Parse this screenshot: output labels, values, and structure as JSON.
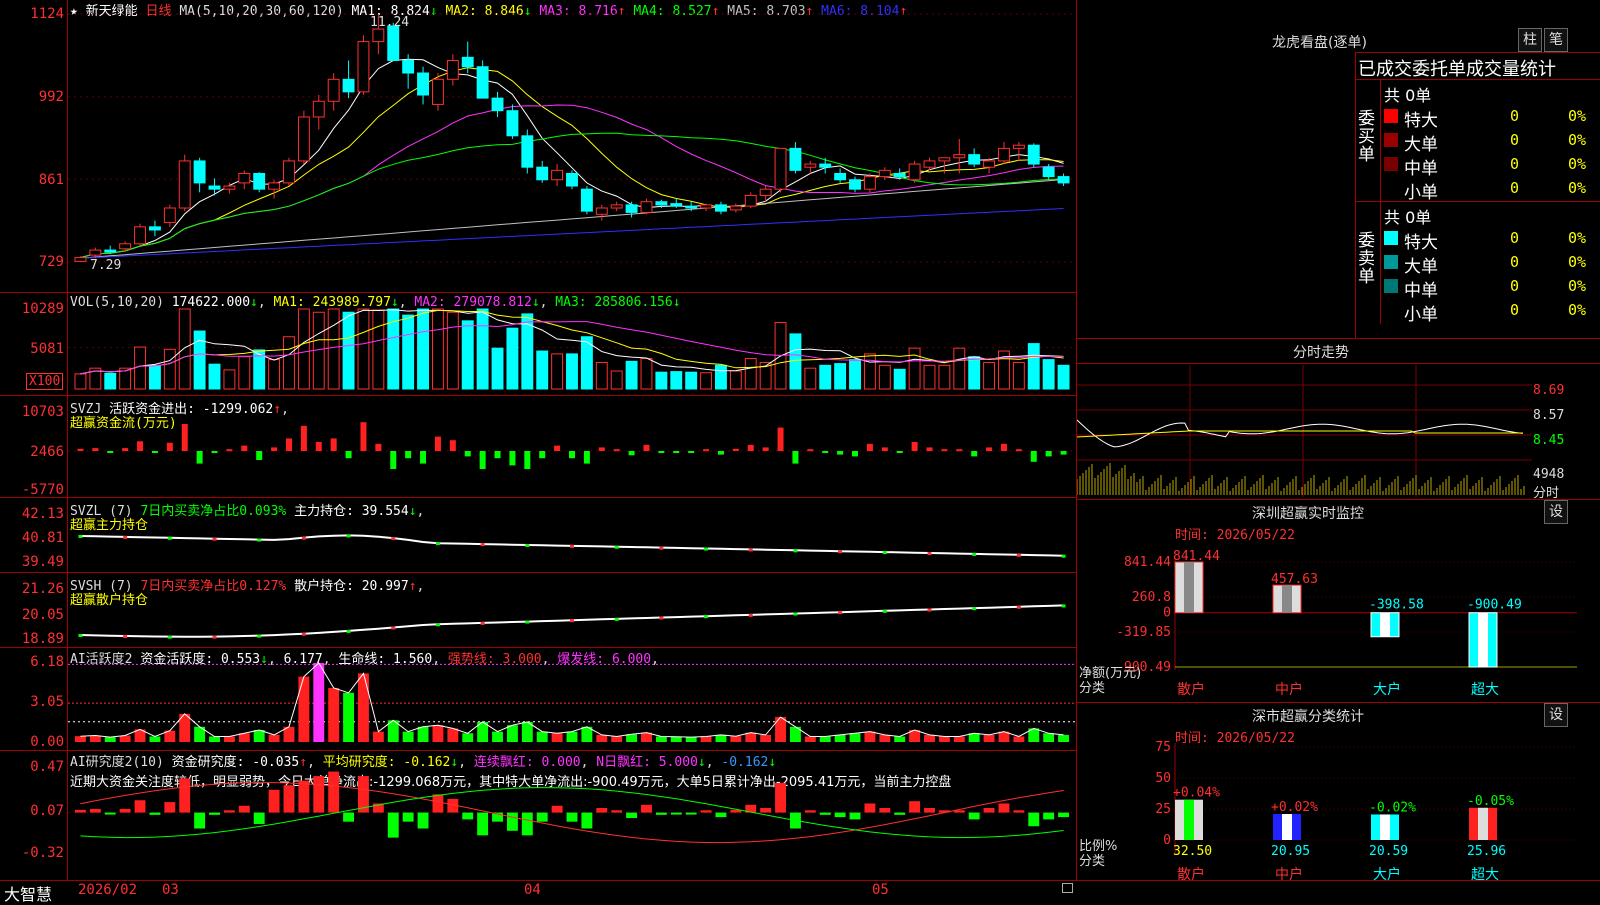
{
  "stock": {
    "name": "新天绿能",
    "period": "日线",
    "ma_label": "MA(5,10,20,30,60,120)",
    "ma": [
      {
        "label": "MA1:",
        "value": "8.824",
        "arrow": "↓",
        "color": "#ffffff"
      },
      {
        "label": "MA2:",
        "value": "8.846",
        "arrow": "↓",
        "color": "#ffff00"
      },
      {
        "label": "MA3:",
        "value": "8.716",
        "arrow": "↑",
        "color": "#ff33ff"
      },
      {
        "label": "MA4:",
        "value": "8.527",
        "arrow": "↑",
        "color": "#00ff00"
      },
      {
        "label": "MA5:",
        "value": "8.703",
        "arrow": "↑",
        "color": "#c0c0c0"
      },
      {
        "label": "MA6:",
        "value": "8.104",
        "arrow": "↑",
        "color": "#3030ff"
      }
    ],
    "high_label": "11.24",
    "low_label": "7.29",
    "yticks": [
      "1124",
      "992",
      "861",
      "729"
    ]
  },
  "vol": {
    "title": "VOL(5,10,20)",
    "value": "174622.000",
    "ma1": "MA1: 243989.797",
    "ma2": "MA2: 279078.812",
    "ma3": "MA3: 285806.156",
    "yticks": [
      "10289",
      "5081"
    ],
    "unit": "X100"
  },
  "svzj": {
    "title": "SVZJ",
    "text": "活跃资金进出: -1299.062",
    "subtitle": "超赢资金流(万元)",
    "yticks": [
      "10703",
      "2466",
      "-5770"
    ]
  },
  "svzl": {
    "title": "SVZL (7)",
    "text1": "7日内买卖净占比0.093%",
    "text2": "主力持仓: 39.554",
    "subtitle": "超赢主力持仓",
    "yticks": [
      "42.13",
      "40.81",
      "39.49"
    ]
  },
  "svsh": {
    "title": "SVSH (7)",
    "text1": "7日内买卖净占比0.127%",
    "text2": "散户持仓: 20.997",
    "subtitle": "超赢散户持仓",
    "yticks": [
      "21.26",
      "20.05",
      "18.89"
    ]
  },
  "ai1": {
    "title": "AI活跃度2",
    "text": "资金活跃度: 0.553",
    "v2": "6.177",
    "life": "生命线: 1.560",
    "strong": "强势线: 3.000",
    "burst": "爆发线: 6.000",
    "yticks": [
      "6.18",
      "3.05",
      "0.00"
    ]
  },
  "ai2": {
    "title": "AI研究度2(10)",
    "text": "资金研究度: -0.035",
    "avg": "平均研究度: -0.162",
    "cont": "连续飘红: 0.000",
    "nday": "N日飘红: 5.000",
    "last": "-0.162",
    "note": "近期大资金关注度较低，明显弱势，今日大单净流出:-1299.068万元，其中特大单净流出:-900.49万元，大单5日累计净出-2095.41万元，当前主力控盘",
    "yticks": [
      "0.47",
      "0.07",
      "-0.32"
    ]
  },
  "bottom": {
    "logo": "大智慧",
    "dates": [
      "2026/02",
      "03",
      "04",
      "05"
    ]
  },
  "right": {
    "lhb_title": "龙虎看盘(逐单)",
    "btn_zhu": "柱",
    "btn_bi": "笔",
    "header": "已成交委托单成交量统计",
    "buy_side": "委买单",
    "sell_side": "委卖单",
    "buy_total": "共 0单",
    "sell_total": "共 0单",
    "buy_rows": [
      {
        "name": "特大",
        "count": "0",
        "pct": "0%",
        "color": "#ff0000"
      },
      {
        "name": "大单",
        "count": "0",
        "pct": "0%",
        "color": "#990000"
      },
      {
        "name": "中单",
        "count": "0",
        "pct": "0%",
        "color": "#770000"
      },
      {
        "name": "小单",
        "count": "0",
        "pct": "0%",
        "color": "#000000"
      }
    ],
    "sell_rows": [
      {
        "name": "特大",
        "count": "0",
        "pct": "0%",
        "color": "#00ffff"
      },
      {
        "name": "大单",
        "count": "0",
        "pct": "0%",
        "color": "#009999"
      },
      {
        "name": "中单",
        "count": "0",
        "pct": "0%",
        "color": "#007777"
      },
      {
        "name": "小单",
        "count": "0",
        "pct": "0%",
        "color": "#000000"
      }
    ],
    "fs_title": "分时走势",
    "fs_yticks": [
      "8.69",
      "8.57",
      "8.45"
    ],
    "fs_vol": "4948",
    "fs_unit": "分时",
    "sz_title": "深圳超赢实时监控",
    "sz_btn": "设",
    "sz_time": "时间: 2026/05/22",
    "sz_yticks": [
      "841.44",
      "260.8",
      "0",
      "-319.85",
      "-900.49"
    ],
    "sz_ylabel1": "净额(万元)",
    "sz_ylabel2": "分类",
    "sz_cats": [
      "散户",
      "中户",
      "大户",
      "超大"
    ],
    "sz_values": [
      "841.44",
      "457.63",
      "-398.58",
      "-900.49"
    ],
    "cl_title": "深市超赢分类统计",
    "cl_btn": "设",
    "cl_time": "时间: 2026/05/22",
    "cl_yticks": [
      "75",
      "50",
      "25",
      "0"
    ],
    "cl_ylabel1": "比例%",
    "cl_ylabel2": "分类",
    "cl_cats": [
      "散户",
      "中户",
      "大户",
      "超大"
    ],
    "cl_values": [
      "32.50",
      "20.95",
      "20.59",
      "25.96"
    ],
    "cl_changes": [
      "+0.04%",
      "+0.02%",
      "-0.02%",
      "-0.05%"
    ]
  },
  "chart_data": [
    {
      "type": "line",
      "name": "price",
      "ylim": [
        7.29,
        11.24
      ],
      "candles": [
        [
          7.3,
          7.38,
          7.29,
          7.36
        ],
        [
          7.4,
          7.52,
          7.35,
          7.48
        ],
        [
          7.48,
          7.55,
          7.42,
          7.45
        ],
        [
          7.5,
          7.62,
          7.45,
          7.58
        ],
        [
          7.58,
          7.9,
          7.55,
          7.85
        ],
        [
          7.85,
          7.95,
          7.7,
          7.8
        ],
        [
          7.92,
          8.2,
          7.85,
          8.15
        ],
        [
          8.15,
          9.0,
          8.1,
          8.9
        ],
        [
          8.9,
          8.95,
          8.4,
          8.55
        ],
        [
          8.5,
          8.62,
          8.35,
          8.45
        ],
        [
          8.45,
          8.55,
          8.38,
          8.5
        ],
        [
          8.55,
          8.75,
          8.45,
          8.7
        ],
        [
          8.7,
          8.72,
          8.4,
          8.45
        ],
        [
          8.45,
          8.6,
          8.3,
          8.55
        ],
        [
          8.55,
          8.95,
          8.5,
          8.9
        ],
        [
          8.9,
          9.7,
          8.85,
          9.6
        ],
        [
          9.6,
          9.95,
          9.4,
          9.85
        ],
        [
          9.85,
          10.3,
          9.7,
          10.2
        ],
        [
          10.2,
          10.5,
          9.9,
          10.0
        ],
        [
          10.0,
          10.9,
          9.95,
          10.8
        ],
        [
          10.8,
          11.24,
          10.6,
          11.0
        ],
        [
          11.05,
          11.1,
          10.6,
          10.5
        ],
        [
          10.5,
          10.6,
          10.05,
          10.3
        ],
        [
          10.3,
          10.4,
          9.8,
          9.95
        ],
        [
          9.8,
          10.3,
          9.7,
          10.2
        ],
        [
          10.2,
          10.6,
          10.1,
          10.5
        ],
        [
          10.55,
          10.8,
          10.3,
          10.4
        ],
        [
          10.4,
          10.5,
          9.9,
          9.9
        ],
        [
          9.9,
          10.0,
          9.6,
          9.7
        ],
        [
          9.7,
          9.8,
          9.25,
          9.3
        ],
        [
          9.3,
          9.4,
          8.7,
          8.8
        ],
        [
          8.8,
          8.9,
          8.55,
          8.6
        ],
        [
          8.6,
          8.85,
          8.5,
          8.75
        ],
        [
          8.7,
          8.75,
          8.45,
          8.5
        ],
        [
          8.45,
          8.5,
          8.05,
          8.1
        ],
        [
          8.05,
          8.2,
          7.95,
          8.15
        ],
        [
          8.15,
          8.25,
          8.1,
          8.2
        ],
        [
          8.2,
          8.25,
          8.0,
          8.08
        ],
        [
          8.08,
          8.3,
          8.05,
          8.25
        ],
        [
          8.25,
          8.28,
          8.15,
          8.2
        ],
        [
          8.22,
          8.3,
          8.15,
          8.18
        ],
        [
          8.18,
          8.25,
          8.1,
          8.15
        ],
        [
          8.15,
          8.22,
          8.1,
          8.2
        ],
        [
          8.2,
          8.25,
          8.05,
          8.1
        ],
        [
          8.12,
          8.22,
          8.08,
          8.18
        ],
        [
          8.18,
          8.4,
          8.15,
          8.35
        ],
        [
          8.35,
          8.5,
          8.25,
          8.45
        ],
        [
          8.45,
          8.8,
          8.4,
          9.1
        ],
        [
          9.1,
          9.2,
          8.7,
          8.75
        ],
        [
          8.8,
          8.9,
          8.7,
          8.85
        ],
        [
          8.85,
          8.95,
          8.7,
          8.8
        ],
        [
          8.7,
          8.78,
          8.55,
          8.6
        ],
        [
          8.6,
          8.65,
          8.4,
          8.45
        ],
        [
          8.45,
          8.7,
          8.4,
          8.65
        ],
        [
          8.65,
          8.8,
          8.6,
          8.75
        ],
        [
          8.7,
          8.78,
          8.6,
          8.65
        ],
        [
          8.6,
          8.9,
          8.55,
          8.85
        ],
        [
          8.8,
          8.95,
          8.75,
          8.9
        ],
        [
          8.9,
          8.95,
          8.7,
          8.95
        ],
        [
          8.95,
          9.25,
          8.7,
          9.0
        ],
        [
          9.0,
          9.1,
          8.8,
          8.85
        ],
        [
          8.8,
          8.95,
          8.7,
          8.9
        ],
        [
          8.9,
          9.2,
          8.85,
          9.1
        ],
        [
          9.1,
          9.2,
          8.9,
          9.15
        ],
        [
          9.15,
          9.18,
          8.8,
          8.85
        ],
        [
          8.8,
          8.85,
          8.6,
          8.65
        ],
        [
          8.65,
          8.7,
          8.5,
          8.55
        ]
      ],
      "ma_series": [
        "MA1",
        "MA2",
        "MA3",
        "MA4",
        "MA5",
        "MA6"
      ]
    },
    {
      "type": "bar",
      "name": "VOL",
      "ylim": [
        0,
        10289
      ]
    },
    {
      "type": "bar",
      "name": "SVZJ",
      "ylim": [
        -5770,
        10703
      ]
    },
    {
      "type": "line",
      "name": "SVZL",
      "ylim": [
        39.49,
        42.13
      ]
    },
    {
      "type": "line",
      "name": "SVSH",
      "ylim": [
        18.89,
        21.26
      ]
    },
    {
      "type": "bar",
      "name": "AI活跃度2",
      "ylim": [
        0,
        6.18
      ]
    },
    {
      "type": "bar",
      "name": "AI研究度2(10)",
      "ylim": [
        -0.32,
        0.47
      ]
    }
  ]
}
